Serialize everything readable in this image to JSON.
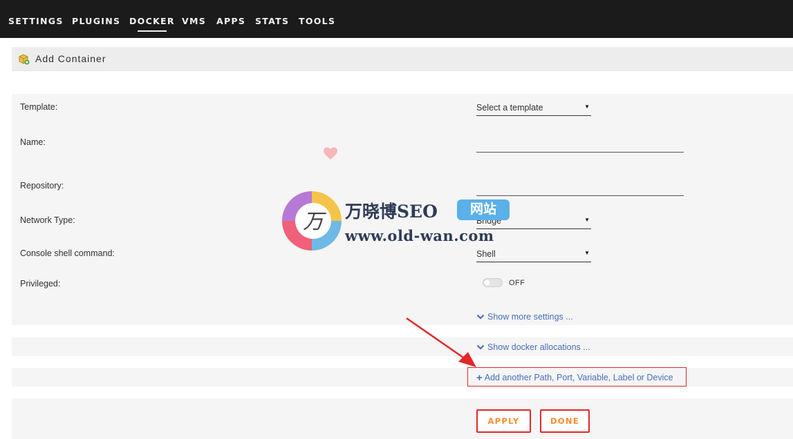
{
  "nav": {
    "items": [
      {
        "label": "SETTINGS"
      },
      {
        "label": "PLUGINS"
      },
      {
        "label": "DOCKER"
      },
      {
        "label": "VMS"
      },
      {
        "label": "APPS"
      },
      {
        "label": "STATS"
      },
      {
        "label": "TOOLS"
      }
    ],
    "active": "DOCKER"
  },
  "page": {
    "title": "Add Container",
    "icon": "docker-container-icon"
  },
  "form": {
    "template": {
      "label": "Template:",
      "value": "Select a template"
    },
    "name": {
      "label": "Name:",
      "value": ""
    },
    "repository": {
      "label": "Repository:",
      "value": ""
    },
    "network_type": {
      "label": "Network Type:",
      "value": "Bridge"
    },
    "console_shell": {
      "label": "Console shell command:",
      "value": "Shell"
    },
    "privileged": {
      "label": "Privileged:",
      "state": "OFF"
    }
  },
  "links": {
    "show_more_settings": "Show more settings ...",
    "show_docker_allocations": "Show docker allocations ...",
    "add_another": "Add another Path, Port, Variable, Label or Device"
  },
  "buttons": {
    "apply": "APPLY",
    "done": "DONE"
  },
  "watermark": {
    "cn_text": "万晓博SEO",
    "badge": "网站",
    "url": "www.old-wan.com",
    "logo_char": "万"
  },
  "colors": {
    "topbar": "#1c1b1b",
    "link": "#486dba",
    "button_text": "#ff8c2f",
    "annotation_red": "#e22828"
  }
}
